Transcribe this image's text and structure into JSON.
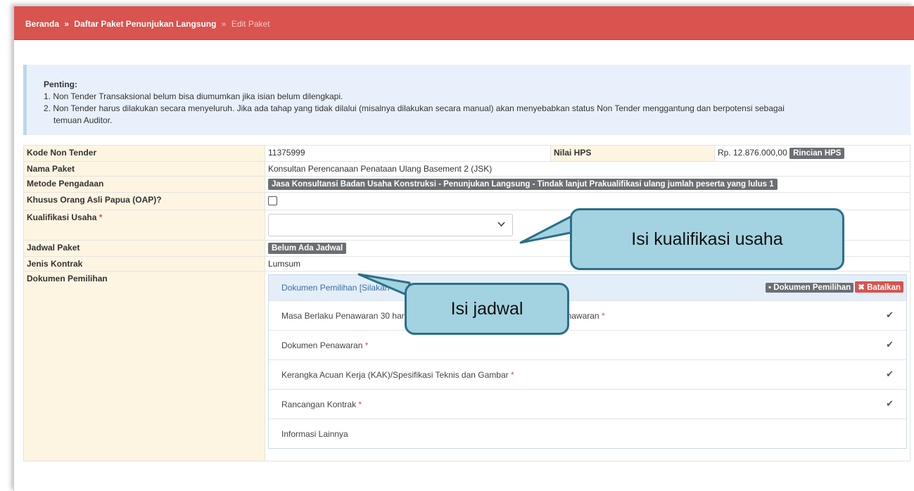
{
  "breadcrumb": {
    "home": "Beranda",
    "sep": "»",
    "list": "Daftar Paket Penunjukan Langsung",
    "current": "Edit Paket"
  },
  "alert": {
    "title": "Penting:",
    "line1": "1. Non Tender Transaksional belum bisa diumumkan jika isian belum dilengkapi.",
    "line2": "2. Non Tender harus dilakukan secara menyeluruh. Jika ada tahap yang tidak dilalui (misalnya dilakukan secara manual) akan menyebabkan status Non Tender menggantung dan berpotensi sebagai",
    "line3": "temuan Auditor."
  },
  "form": {
    "kode_label": "Kode Non Tender",
    "kode_value": "11375999",
    "hps_label": "Nilai HPS",
    "hps_value": "Rp. 12.876.000,00",
    "hps_button": "Rincian HPS",
    "nama_label": "Nama Paket",
    "nama_value": "Konsultan Perencanaan Penataan Ulang Basement 2 (JSK)",
    "metode_label": "Metode Pengadaan",
    "metode_value": "Jasa Konsultansi Badan Usaha Konstruksi - Penunjukan Langsung - Tindak lanjut Prakualifikasi ulang jumlah peserta yang lulus 1",
    "oap_label": "Khusus Orang Asli Papua (OAP)?",
    "kualifikasi_label": "Kualifikasi Usaha",
    "required_mark": "*",
    "jadwal_label": "Jadwal Paket",
    "jadwal_value": "Belum Ada Jadwal",
    "kontrak_label": "Jenis Kontrak",
    "kontrak_value": "Lumsum",
    "dokumen_label": "Dokumen Pemilihan"
  },
  "panel": {
    "title": "Dokumen Pemilihan [Silakan",
    "doc_button": "Dokumen Pemilihan",
    "cancel_button": "Batalkan",
    "rows": [
      {
        "label": "Masa Berlaku Penawaran 30 hari sejak batas akhir pemasukan dokumen penawaran",
        "required": "*",
        "done": "✔"
      },
      {
        "label": "Dokumen Penawaran",
        "required": "*",
        "done": "✔"
      },
      {
        "label": "Kerangka Acuan Kerja (KAK)/Spesifikasi Teknis dan Gambar",
        "required": "*",
        "done": "✔"
      },
      {
        "label": "Rancangan Kontrak",
        "required": "*",
        "done": "✔"
      },
      {
        "label": "Informasi Lainnya",
        "required": "",
        "done": ""
      }
    ]
  },
  "callouts": {
    "kualifikasi": "Isi kualifikasi usaha",
    "jadwal": "Isi jadwal"
  }
}
